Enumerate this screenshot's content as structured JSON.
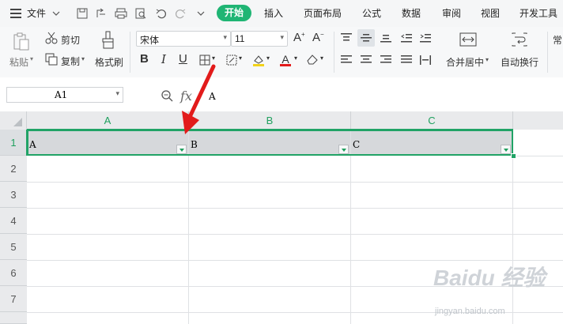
{
  "menu": {
    "file_label": "文件",
    "tabs": [
      "开始",
      "插入",
      "页面布局",
      "公式",
      "数据",
      "审阅",
      "视图",
      "开发工具"
    ]
  },
  "ribbon": {
    "paste": "粘贴",
    "cut": "剪切",
    "copy": "复制",
    "format_painter": "格式刷",
    "font_name": "宋体",
    "font_size": "11",
    "merge_center": "合并居中",
    "wrap_text": "自动换行",
    "cut_off_label": "常"
  },
  "formula_bar": {
    "cell_ref": "A1",
    "fx": "fx",
    "content": "A"
  },
  "grid": {
    "columns": [
      "A",
      "B",
      "C"
    ],
    "rows": [
      "1",
      "2",
      "3",
      "4",
      "5",
      "6",
      "7"
    ],
    "row1": [
      "A",
      "B",
      "C"
    ]
  },
  "watermark": {
    "brand": "Baidu 经验",
    "url": "jingyan.baidu.com"
  },
  "colors": {
    "accent_green": "#1fb574",
    "selection_green": "#21a366",
    "arrow_red": "#e21b1b"
  }
}
